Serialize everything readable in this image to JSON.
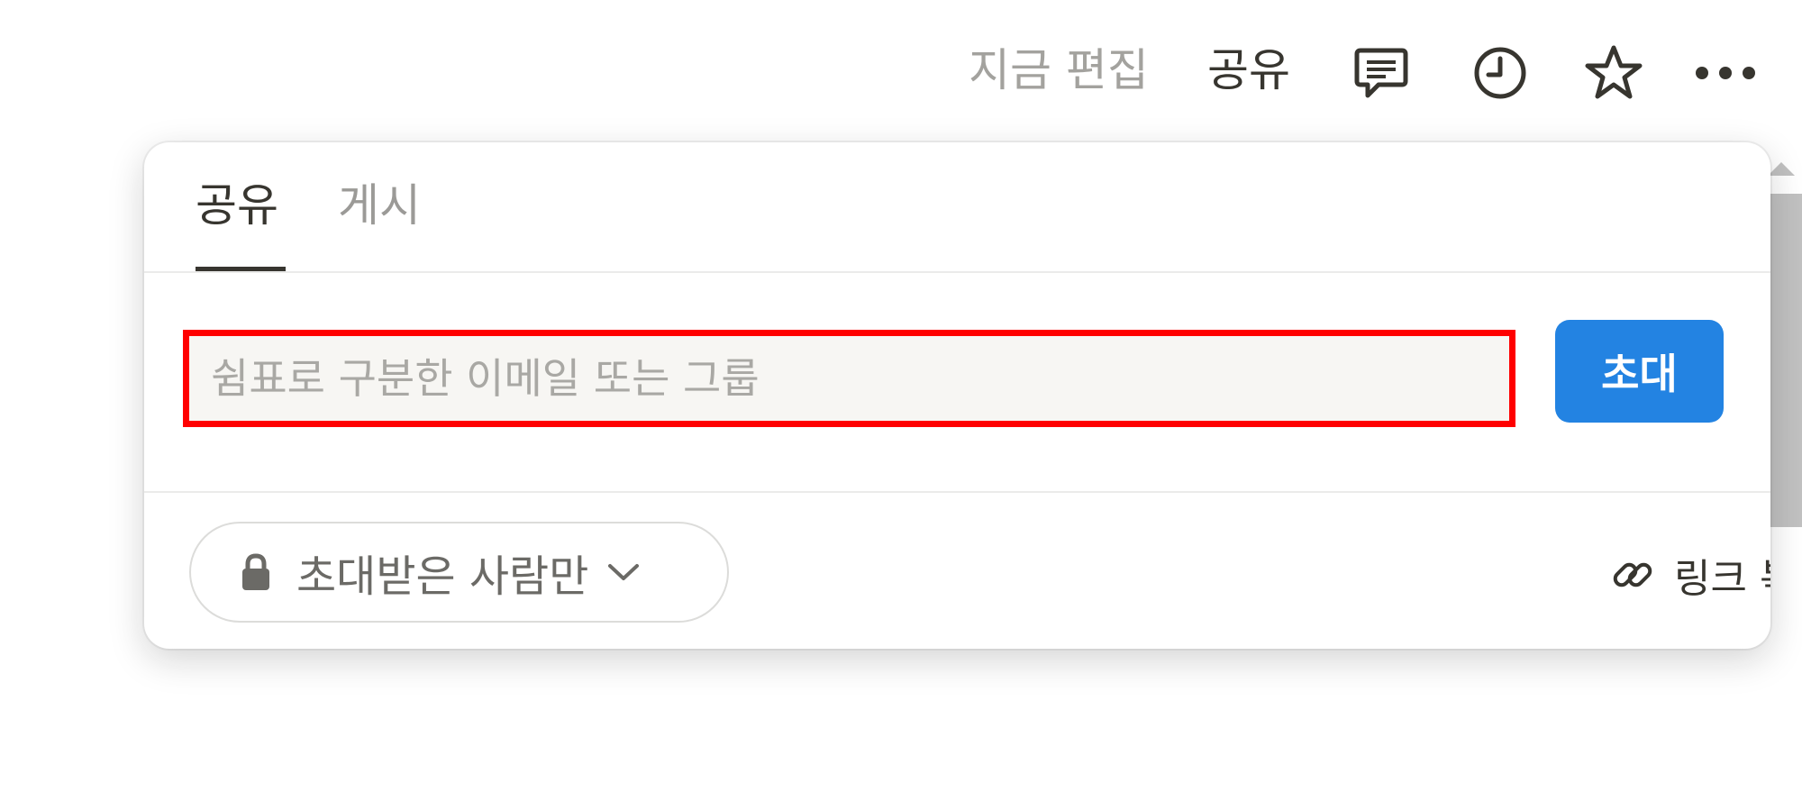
{
  "topbar": {
    "edited_label": "지금 편집",
    "share_label": "공유",
    "icons": [
      "comment-icon",
      "history-clock-icon",
      "favorite-star-icon",
      "more-dots-icon"
    ]
  },
  "share_popup": {
    "tabs": [
      {
        "label": "공유",
        "active": true
      },
      {
        "label": "게시",
        "active": false
      }
    ],
    "invite": {
      "placeholder": "쉼표로 구분한 이메일 또는 그룹",
      "value": "",
      "button_label": "초대"
    },
    "access": {
      "selected": "초대받은 사람만",
      "icon": "lock-icon"
    },
    "copy_link_label": "링크 복사"
  },
  "colors": {
    "accent": "#2383e2",
    "highlight_border": "#ff0000",
    "text_primary": "#37352f",
    "text_muted": "#9b9a97"
  }
}
